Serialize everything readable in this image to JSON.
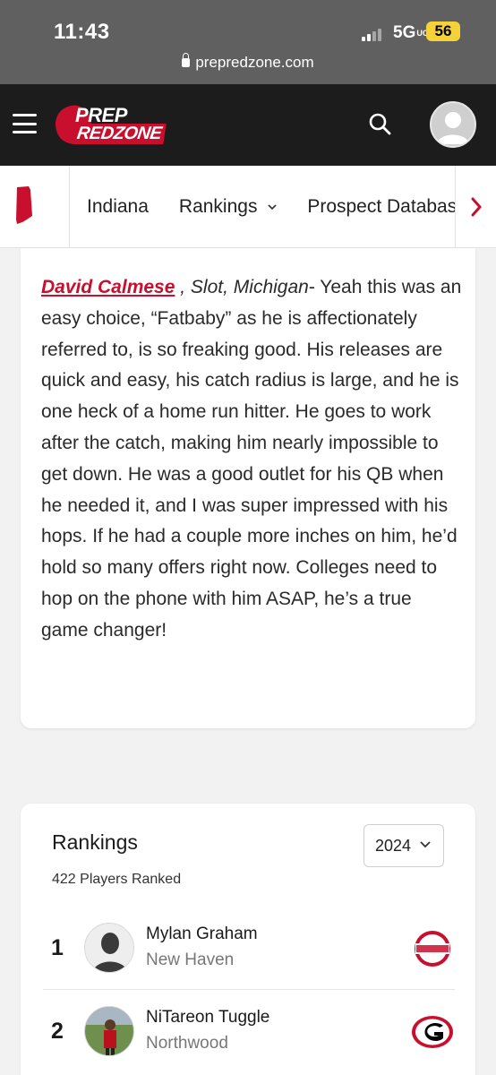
{
  "status_bar": {
    "time": "11:43",
    "network": "5G",
    "network_sup": "UC",
    "battery": "56",
    "url": "prepredzone.com"
  },
  "header": {
    "logo_top": "PREP",
    "logo_bottom": "REDZONE"
  },
  "nav": {
    "items": [
      "Indiana",
      "Rankings",
      "Prospect Database"
    ],
    "rankings_has_dropdown": true
  },
  "article": {
    "player_name": "David Calmese",
    "meta": " , Slot, Michigan",
    "body": "- Yeah this was an easy choice, “Fatbaby” as he is affectionately referred to, is so freaking good. His releases are quick and easy, his catch radius is large, and he is one heck of a home run hitter. He goes to work after the catch, making him nearly impossible to get down. He was a good outlet for his QB when he needed it, and I was super impressed with his hops. If he had a couple more inches on him, he’d hold so many offers right now. Colleges need to hop on the phone with him ASAP, he’s a true game changer!"
  },
  "rankings": {
    "title": "Rankings",
    "count": "422 Players Ranked",
    "year": "2024",
    "players": [
      {
        "rank": "1",
        "name": "Mylan Graham",
        "school": "New Haven",
        "college_logo": "ohio-state-logo"
      },
      {
        "rank": "2",
        "name": "NiTareon Tuggle",
        "school": "Northwood",
        "college_logo": "georgia-logo"
      }
    ]
  },
  "colors": {
    "brand_red": "#c8102e",
    "header_bg": "#1c1c1c",
    "status_bg": "#606060",
    "battery": "#f5d23a"
  }
}
